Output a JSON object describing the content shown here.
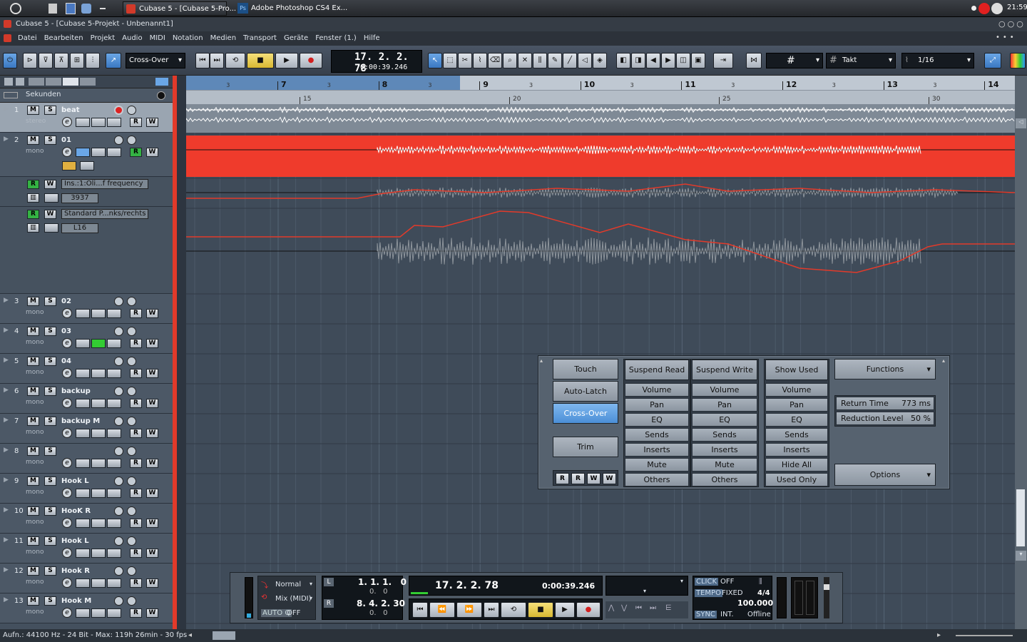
{
  "taskbar": {
    "items": [
      {
        "label": "Cubase 5 - [Cubase 5-Pro..."
      },
      {
        "label": "Adobe Photoshop CS4 Ex..."
      }
    ],
    "clock": "21:59"
  },
  "window_title": "Cubase 5 - [Cubase 5-Projekt - Unbenannt1]",
  "menu": [
    "Datei",
    "Bearbeiten",
    "Projekt",
    "Audio",
    "MIDI",
    "Notation",
    "Medien",
    "Transport",
    "Geräte",
    "Fenster (1.)",
    "Hilfe"
  ],
  "toolbar": {
    "automation_mode": "Cross-Over",
    "position_bars": "17. 2. 2. 78",
    "position_time": "0:00:39.246",
    "grid_type": "Takt",
    "quantize": "1/16"
  },
  "tracklist": {
    "header": "Sekunden",
    "tracks": [
      {
        "num": "1",
        "name": "beat",
        "type": "stereo"
      },
      {
        "num": "2",
        "name": "01",
        "type": "mono"
      },
      {
        "num": "3",
        "name": "02",
        "type": "mono"
      },
      {
        "num": "4",
        "name": "03",
        "type": "mono"
      },
      {
        "num": "5",
        "name": "04",
        "type": "mono"
      },
      {
        "num": "6",
        "name": "backup",
        "type": "mono"
      },
      {
        "num": "7",
        "name": "backup M",
        "type": "mono"
      },
      {
        "num": "8",
        "name": "",
        "type": "mono"
      },
      {
        "num": "9",
        "name": "Hook L",
        "type": "mono"
      },
      {
        "num": "10",
        "name": "HooK R",
        "type": "mono"
      },
      {
        "num": "11",
        "name": "Hook L",
        "type": "mono"
      },
      {
        "num": "12",
        "name": "Hook R",
        "type": "mono"
      },
      {
        "num": "13",
        "name": "Hook M",
        "type": "mono"
      }
    ],
    "automation": [
      {
        "param": "Ins.:1:Oli...f frequency",
        "value": "3937"
      },
      {
        "param": "Standard P...nks/rechts",
        "value": "L16"
      }
    ],
    "buttons": {
      "m": "M",
      "s": "S",
      "r": "R",
      "w": "W",
      "e": "e"
    }
  },
  "ruler": {
    "bars": [
      "7",
      "8",
      "9",
      "10",
      "11",
      "12",
      "13",
      "14"
    ],
    "sub": [
      "3",
      "3",
      "3",
      "3",
      "3",
      "3",
      "3",
      "3"
    ],
    "seconds": [
      "15",
      "20",
      "25",
      "30"
    ]
  },
  "automation_panel": {
    "modes": [
      "Touch",
      "Auto-Latch",
      "Cross-Over"
    ],
    "trim": "Trim",
    "rw_buttons": [
      "R",
      "R",
      "W",
      "W"
    ],
    "suspend_read": {
      "header": "Suspend Read",
      "items": [
        "Volume",
        "Pan",
        "EQ",
        "Sends",
        "Inserts",
        "Mute",
        "Others"
      ]
    },
    "suspend_write": {
      "header": "Suspend Write",
      "items": [
        "Volume",
        "Pan",
        "EQ",
        "Sends",
        "Inserts",
        "Mute",
        "Others"
      ]
    },
    "show_used": {
      "header": "Show Used",
      "items": [
        "Volume",
        "Pan",
        "EQ",
        "Sends",
        "Inserts",
        "Hide All",
        "Used Only"
      ]
    },
    "functions": "Functions",
    "return_time_label": "Return Time",
    "return_time_value": "773 ms",
    "reduction_label": "Reduction Level",
    "reduction_value": "50 %",
    "options": "Options"
  },
  "transport": {
    "mode_normal": "Normal",
    "mode_mix": "Mix (MIDI)",
    "autoq": "AUTO Q",
    "autoq_value": "OFF",
    "left_locator": "1. 1. 1.   0",
    "left_sub": "0.   0",
    "right_locator": "8. 4. 2. 30",
    "right_sub": "0.   0",
    "position_bars": "17. 2. 2. 78",
    "position_time": "0:00:39.246",
    "click_label": "CLICK",
    "click_value": "OFF",
    "tempo_label": "TEMPO",
    "tempo_mode": "FIXED",
    "signature": "4/4",
    "tempo_value": "100.000",
    "sync_label": "SYNC",
    "sync_mode": "INT.",
    "sync_status": "Offline"
  },
  "status": "Aufn.: 44100 Hz - 24 Bit - Max: 119h 26min - 30 fps -"
}
